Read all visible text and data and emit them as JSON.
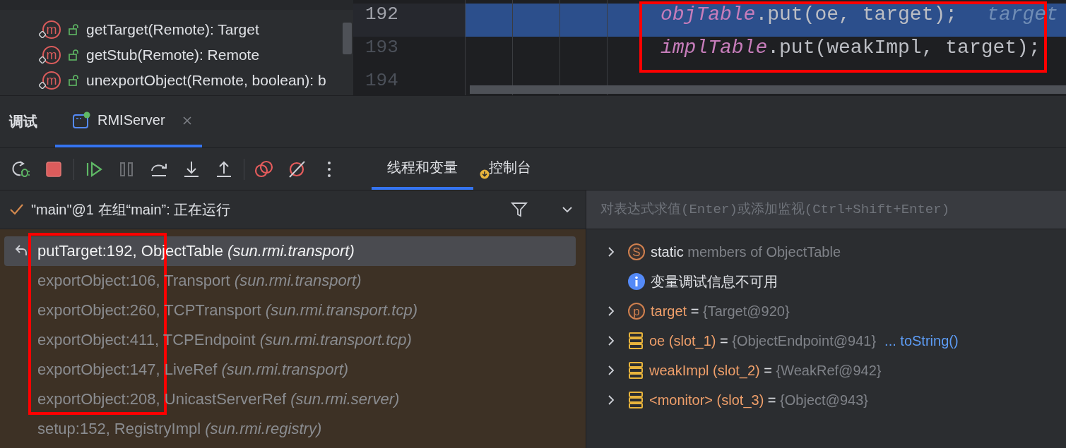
{
  "structure": {
    "items": [
      {
        "badge": "m",
        "name": "getTarget(Remote): Target"
      },
      {
        "badge": "m",
        "name": "getStub(Remote): Remote"
      },
      {
        "badge": "m",
        "name": "unexportObject(Remote, boolean): b"
      }
    ]
  },
  "editor": {
    "lines": [
      {
        "number": "192",
        "current": true,
        "tokens": [
          {
            "kind": "field",
            "text": "objTable"
          },
          {
            "kind": "plain",
            "text": ".put(oe, target);"
          },
          {
            "kind": "hint",
            "text": "target"
          }
        ]
      },
      {
        "number": "193",
        "current": false,
        "tokens": [
          {
            "kind": "field",
            "text": "implTable"
          },
          {
            "kind": "plain",
            "text": ".put(weakImpl, target);"
          }
        ]
      },
      {
        "number": "194",
        "current": false
      }
    ]
  },
  "debug_tabs": {
    "title": "调试",
    "tabs": [
      {
        "label": "RMIServer",
        "selected": true,
        "closable": true
      }
    ]
  },
  "toolbar": [
    {
      "kind": "rerun",
      "disabled": false
    },
    {
      "kind": "stop",
      "disabled": false
    },
    {
      "kind": "separator"
    },
    {
      "kind": "resume",
      "disabled": false
    },
    {
      "kind": "pause",
      "disabled": true
    },
    {
      "kind": "step-over",
      "disabled": false
    },
    {
      "kind": "step-into",
      "disabled": false
    },
    {
      "kind": "step-out",
      "disabled": false
    },
    {
      "kind": "separator"
    },
    {
      "kind": "breakpoints",
      "disabled": false
    },
    {
      "kind": "mute",
      "disabled": false
    },
    {
      "kind": "more",
      "disabled": false
    }
  ],
  "subtabs": [
    {
      "label": "线程和变量",
      "selected": true,
      "badge": false
    },
    {
      "label": "控制台",
      "selected": false,
      "badge": true
    }
  ],
  "thread": {
    "status": "\"main\"@1 在组“main”: 正在运行"
  },
  "frames": [
    {
      "location": "putTarget:192, ObjectTable",
      "package": "(sun.rmi.transport)",
      "selected": true
    },
    {
      "location": "exportObject:106, Transport",
      "package": "(sun.rmi.transport)",
      "selected": false
    },
    {
      "location": "exportObject:260, TCPTransport",
      "package": "(sun.rmi.transport.tcp)",
      "selected": false
    },
    {
      "location": "exportObject:411, TCPEndpoint",
      "package": "(sun.rmi.transport.tcp)",
      "selected": false
    },
    {
      "location": "exportObject:147, LiveRef",
      "package": "(sun.rmi.transport)",
      "selected": false
    },
    {
      "location": "exportObject:208, UnicastServerRef",
      "package": "(sun.rmi.server)",
      "selected": false
    },
    {
      "location": "setup:152, RegistryImpl",
      "package": "(sun.rmi.registry)",
      "selected": false
    }
  ],
  "evaluate": {
    "placeholder": "对表达式求值(Enter)或添加监视(Ctrl+Shift+Enter)"
  },
  "variables": [
    {
      "kind": "static",
      "badge": "S",
      "expandable": true,
      "name": "static",
      "value": "members of ObjectTable"
    },
    {
      "kind": "info",
      "expandable": false,
      "name": "变量调试信息不可用"
    },
    {
      "kind": "param",
      "badge": "p",
      "expandable": true,
      "name": "target",
      "separator": "=",
      "value": "{Target@920}"
    },
    {
      "kind": "local",
      "expandable": true,
      "name": "oe (slot_1)",
      "separator": "=",
      "value": "{ObjectEndpoint@941}",
      "link": "... toString()"
    },
    {
      "kind": "local",
      "expandable": true,
      "name": "weakImpl (slot_2)",
      "separator": "=",
      "value": "{WeakRef@942}"
    },
    {
      "kind": "local",
      "expandable": true,
      "name": "<monitor> (slot_3)",
      "separator": "=",
      "value": "{Object@943}"
    }
  ],
  "annotations": {
    "code": true,
    "frames": true
  }
}
